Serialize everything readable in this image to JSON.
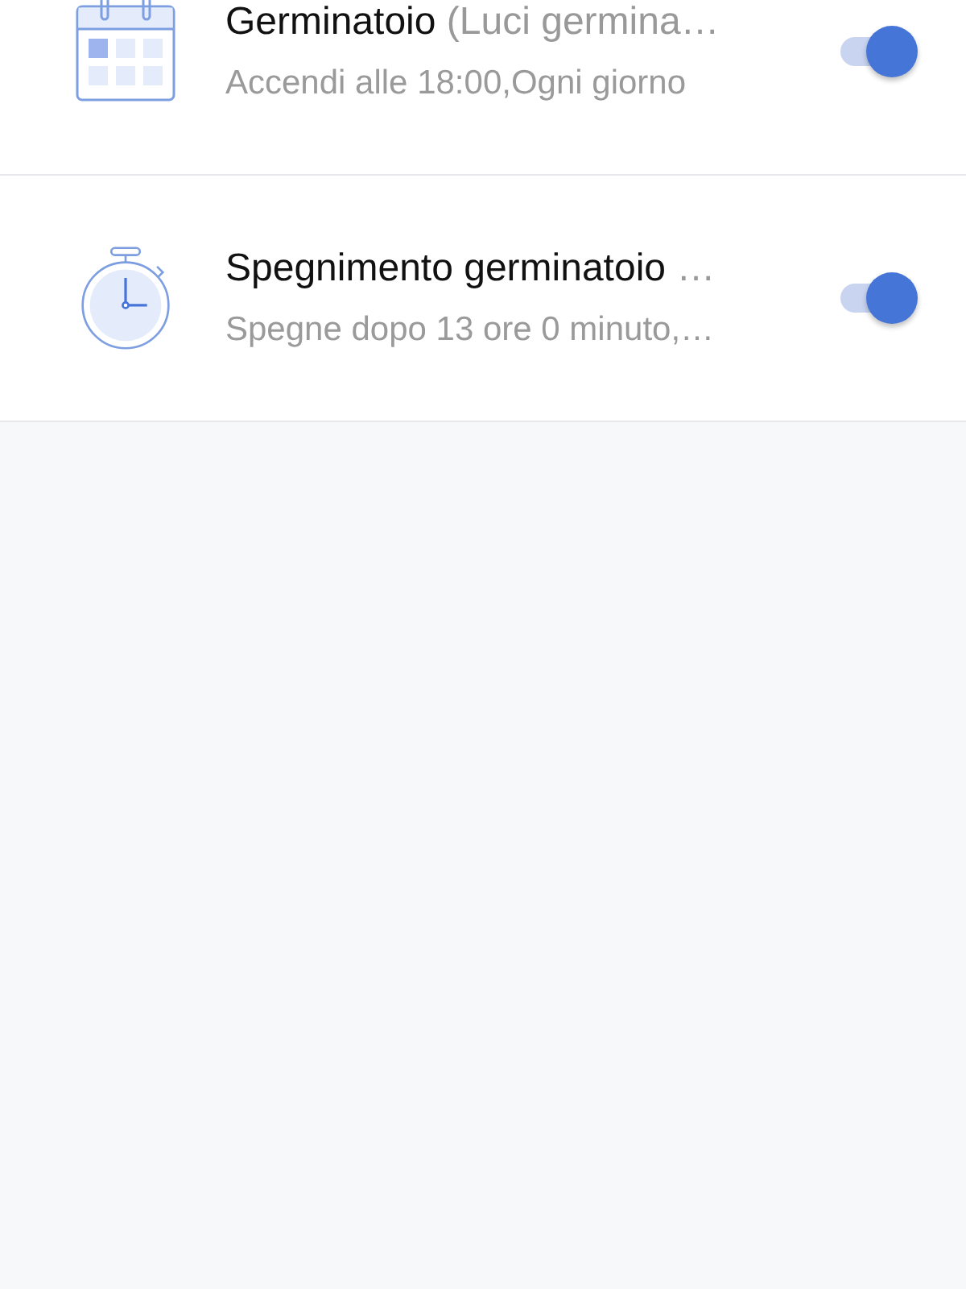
{
  "timers": [
    {
      "kind": "schedule",
      "title": "Germinatoio",
      "title_extra": "(Luci germina…",
      "subtitle": "Accendi alle 18:00,Ogni giorno",
      "on": true
    },
    {
      "kind": "countdown",
      "title": "Spegnimento germinatoio",
      "title_extra": "…",
      "subtitle": "Spegne dopo 13 ore 0 minuto,…",
      "on": true
    }
  ]
}
